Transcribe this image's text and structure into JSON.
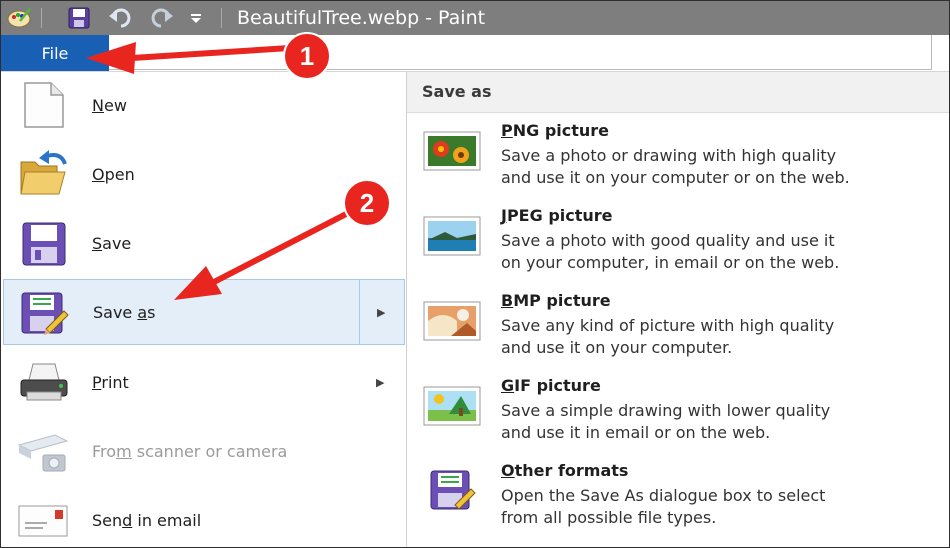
{
  "window": {
    "title": "BeautifulTree.webp - Paint"
  },
  "ribbon": {
    "file_tab": "File"
  },
  "menu": {
    "items": [
      {
        "label_pre": "",
        "label_u": "N",
        "label_post": "ew",
        "icon": "new-document-icon",
        "disabled": false
      },
      {
        "label_pre": "",
        "label_u": "O",
        "label_post": "pen",
        "icon": "open-folder-icon",
        "disabled": false
      },
      {
        "label_pre": "",
        "label_u": "S",
        "label_post": "ave",
        "icon": "save-disk-icon",
        "disabled": false
      },
      {
        "label_pre": "Save ",
        "label_u": "a",
        "label_post": "s",
        "icon": "save-as-icon",
        "disabled": false,
        "selected": true,
        "has_submenu": true
      },
      {
        "label_pre": "",
        "label_u": "P",
        "label_post": "rint",
        "icon": "printer-icon",
        "disabled": false,
        "has_submenu": true
      },
      {
        "label_pre": "Fro",
        "label_u": "m",
        "label_post": " scanner or camera",
        "icon": "scanner-camera-icon",
        "disabled": true
      },
      {
        "label_pre": "Sen",
        "label_u": "d",
        "label_post": " in email",
        "icon": "email-icon",
        "disabled": false
      }
    ]
  },
  "save_as": {
    "header": "Save as",
    "options": [
      {
        "title_u": "P",
        "title_rest": "NG picture",
        "desc1": "Save a photo or drawing with high quality",
        "desc2": "and use it on your computer or on the web.",
        "icon": "png-picture-icon"
      },
      {
        "title_u": "J",
        "title_rest": "PEG picture",
        "desc1": "Save a photo with good quality and use it",
        "desc2": "on your computer, in email or on the web.",
        "icon": "jpeg-picture-icon"
      },
      {
        "title_u": "B",
        "title_rest": "MP picture",
        "desc1": "Save any kind of picture with high quality",
        "desc2": "and use it on your computer.",
        "icon": "bmp-picture-icon"
      },
      {
        "title_u": "G",
        "title_rest": "IF picture",
        "desc1": "Save a simple drawing with lower quality",
        "desc2": "and use it in email or on the web.",
        "icon": "gif-picture-icon"
      },
      {
        "title_u": "O",
        "title_rest": "ther formats",
        "desc1": "Open the Save As dialogue box to select",
        "desc2": "from all possible file types.",
        "icon": "other-formats-icon"
      }
    ]
  },
  "annotations": {
    "badge1": "1",
    "badge2": "2",
    "arrow_color": "#e8261f"
  },
  "colors": {
    "file_tab": "#1960b5",
    "selected_bg": "#e4eef9",
    "titlebar": "#7e7e7e"
  }
}
